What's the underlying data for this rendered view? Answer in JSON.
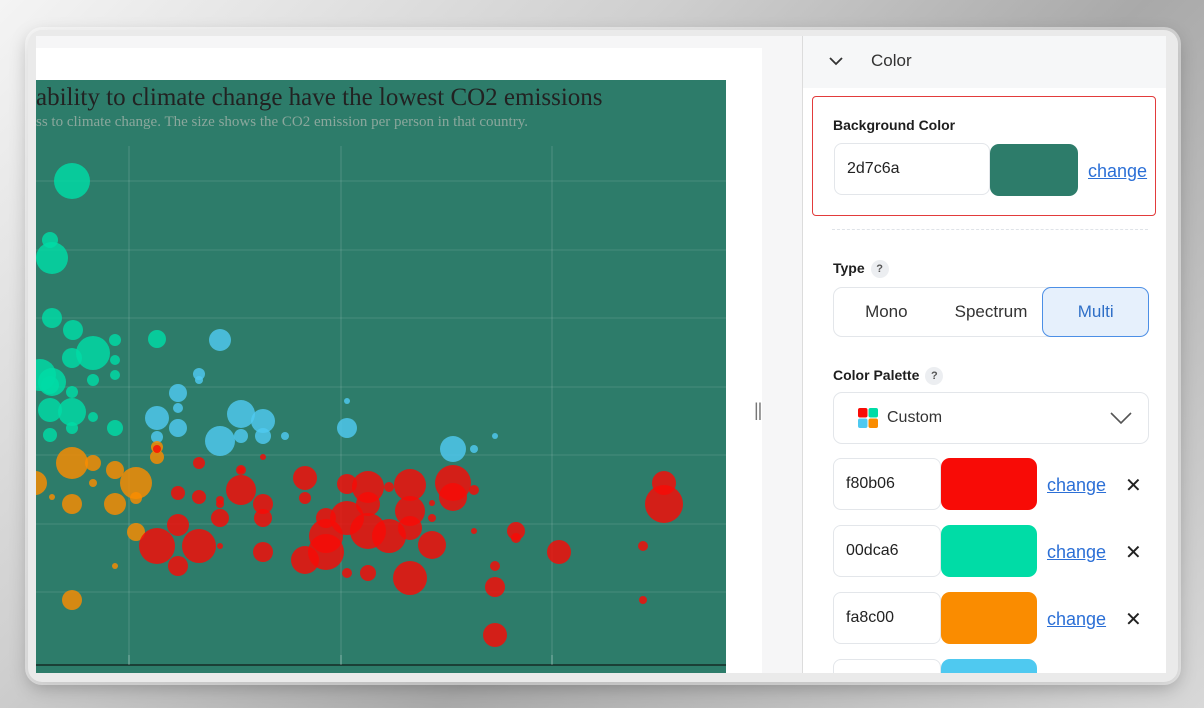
{
  "chart": {
    "title": "ability to climate change have the lowest CO2 emissions",
    "subtitle": "ss to climate change. The size shows the CO2 emission per person in that country.",
    "background": "#2d7c6a"
  },
  "panel": {
    "section_title": "Color",
    "background_color": {
      "label": "Background Color",
      "value": "2d7c6a",
      "swatch": "#2d7c6a",
      "change_label": "change"
    },
    "type": {
      "label": "Type",
      "help": "?",
      "options": [
        "Mono",
        "Spectrum",
        "Multi"
      ],
      "selected": "Multi"
    },
    "palette": {
      "label": "Color Palette",
      "help": "?",
      "selected": "Custom",
      "colors": [
        {
          "hex": "f80b06",
          "swatch": "#f80b06",
          "change_label": "change",
          "remove": "✕"
        },
        {
          "hex": "00dca6",
          "swatch": "#00dca6",
          "change_label": "change",
          "remove": "✕"
        },
        {
          "hex": "fa8c00",
          "swatch": "#fa8c00",
          "change_label": "change",
          "remove": "✕"
        },
        {
          "hex": "",
          "swatch": "#4fc9f0",
          "change_label": "",
          "remove": ""
        }
      ]
    }
  },
  "chart_data": {
    "type": "scatter",
    "title": "ability to climate change have the lowest CO2 emissions",
    "subtitle": "ss to climate change. The size shows the CO2 emission per person in that country.",
    "xlabel": "",
    "ylabel": "",
    "grid": true,
    "series": [
      {
        "color": "#00dca6",
        "points": [
          [
            72,
            181,
            18
          ],
          [
            52,
            258,
            16
          ],
          [
            50,
            240,
            8
          ],
          [
            52,
            318,
            10
          ],
          [
            73,
            330,
            10
          ],
          [
            93,
            353,
            17
          ],
          [
            72,
            358,
            10
          ],
          [
            52,
            382,
            14
          ],
          [
            115,
            340,
            6
          ],
          [
            115,
            360,
            5
          ],
          [
            115,
            375,
            5
          ],
          [
            93,
            380,
            6
          ],
          [
            72,
            392,
            6
          ],
          [
            50,
            410,
            12
          ],
          [
            72,
            412,
            14
          ],
          [
            50,
            385,
            9
          ],
          [
            115,
            428,
            8
          ],
          [
            72,
            428,
            6
          ],
          [
            50,
            435,
            7
          ],
          [
            93,
            417,
            5
          ],
          [
            157,
            339,
            9
          ],
          [
            40,
            375,
            16
          ]
        ]
      },
      {
        "color": "#4fc9f0",
        "points": [
          [
            220,
            340,
            11
          ],
          [
            199,
            374,
            6
          ],
          [
            199,
            380,
            4
          ],
          [
            178,
            393,
            9
          ],
          [
            178,
            408,
            5
          ],
          [
            157,
            418,
            12
          ],
          [
            178,
            428,
            9
          ],
          [
            241,
            414,
            14
          ],
          [
            263,
            421,
            12
          ],
          [
            220,
            441,
            15
          ],
          [
            241,
            436,
            7
          ],
          [
            263,
            436,
            8
          ],
          [
            285,
            436,
            4
          ],
          [
            347,
            428,
            10
          ],
          [
            347,
            401,
            3
          ],
          [
            453,
            449,
            13
          ],
          [
            474,
            449,
            4
          ],
          [
            495,
            436,
            3
          ],
          [
            157,
            437,
            6
          ]
        ]
      },
      {
        "color": "#fa8c00",
        "points": [
          [
            72,
            463,
            16
          ],
          [
            93,
            463,
            8
          ],
          [
            115,
            470,
            9
          ],
          [
            136,
            483,
            16
          ],
          [
            157,
            457,
            7
          ],
          [
            136,
            498,
            6
          ],
          [
            115,
            504,
            11
          ],
          [
            72,
            504,
            10
          ],
          [
            52,
            497,
            3
          ],
          [
            136,
            532,
            9
          ],
          [
            72,
            600,
            10
          ],
          [
            115,
            566,
            3
          ],
          [
            35,
            483,
            12
          ],
          [
            157,
            447,
            6
          ],
          [
            93,
            483,
            4
          ]
        ]
      },
      {
        "color": "#f80b06",
        "points": [
          [
            199,
            463,
            6
          ],
          [
            157,
            449,
            4
          ],
          [
            241,
            490,
            15
          ],
          [
            241,
            470,
            5
          ],
          [
            263,
            504,
            10
          ],
          [
            178,
            493,
            7
          ],
          [
            199,
            497,
            7
          ],
          [
            220,
            504,
            4
          ],
          [
            220,
            518,
            9
          ],
          [
            220,
            500,
            4
          ],
          [
            263,
            518,
            9
          ],
          [
            178,
            525,
            11
          ],
          [
            157,
            546,
            18
          ],
          [
            199,
            546,
            17
          ],
          [
            178,
            566,
            10
          ],
          [
            220,
            546,
            3
          ],
          [
            263,
            552,
            10
          ],
          [
            305,
            478,
            12
          ],
          [
            305,
            560,
            14
          ],
          [
            326,
            536,
            17
          ],
          [
            326,
            518,
            10
          ],
          [
            347,
            484,
            10
          ],
          [
            347,
            518,
            17
          ],
          [
            368,
            487,
            16
          ],
          [
            368,
            504,
            12
          ],
          [
            368,
            531,
            18
          ],
          [
            389,
            536,
            17
          ],
          [
            410,
            485,
            16
          ],
          [
            410,
            511,
            15
          ],
          [
            389,
            487,
            5
          ],
          [
            432,
            545,
            14
          ],
          [
            453,
            483,
            18
          ],
          [
            453,
            497,
            14
          ],
          [
            474,
            490,
            5
          ],
          [
            432,
            518,
            4
          ],
          [
            432,
            503,
            3
          ],
          [
            410,
            528,
            12
          ],
          [
            410,
            578,
            17
          ],
          [
            368,
            573,
            8
          ],
          [
            347,
            573,
            5
          ],
          [
            326,
            552,
            18
          ],
          [
            474,
            531,
            3
          ],
          [
            495,
            566,
            5
          ],
          [
            495,
            587,
            10
          ],
          [
            495,
            635,
            12
          ],
          [
            516,
            531,
            9
          ],
          [
            516,
            538,
            5
          ],
          [
            559,
            552,
            12
          ],
          [
            643,
            546,
            5
          ],
          [
            643,
            600,
            4
          ],
          [
            664,
            504,
            19
          ],
          [
            664,
            483,
            12
          ],
          [
            241,
            470,
            3
          ],
          [
            263,
            457,
            3
          ],
          [
            305,
            498,
            6
          ]
        ]
      }
    ]
  }
}
